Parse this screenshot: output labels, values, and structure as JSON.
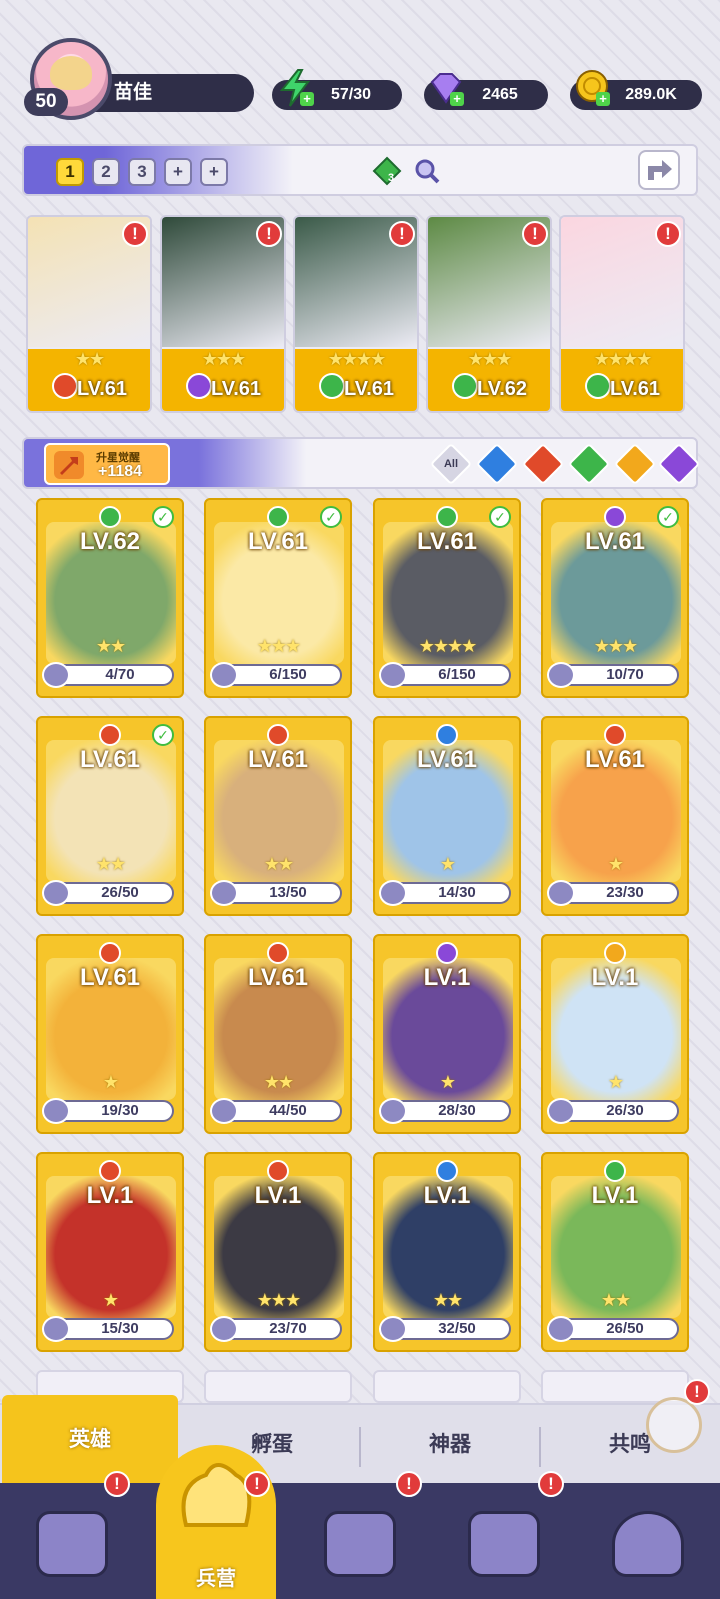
{
  "player": {
    "level": "50",
    "name": "苗佳"
  },
  "resources": {
    "energy": "57/30",
    "gems": "2465",
    "coins": "289.0K"
  },
  "team_tabs": [
    "1",
    "2",
    "3",
    "+",
    "+"
  ],
  "team_gem_count": "3",
  "team_heroes": [
    {
      "level": "LV.61",
      "element": "fire",
      "stars": "★★"
    },
    {
      "level": "LV.61",
      "element": "dark",
      "stars": "★★★"
    },
    {
      "level": "LV.61",
      "element": "wind",
      "stars": "★★★★"
    },
    {
      "level": "LV.62",
      "element": "wind",
      "stars": "★★★"
    },
    {
      "level": "LV.61",
      "element": "wind",
      "stars": "★★★★"
    }
  ],
  "star_up": {
    "label": "升星觉醒",
    "value": "+1184"
  },
  "filters": {
    "all_label": "All"
  },
  "colors": {
    "fire": "#e04a2a",
    "water": "#2f7fe0",
    "wind": "#3db54a",
    "dark": "#8a48d8",
    "light": "#f2a81c",
    "accent": "#f5c41c"
  },
  "heroes": [
    {
      "level": "LV.62",
      "element": "wind",
      "stars": "★★",
      "shards": "4/70",
      "checked": true
    },
    {
      "level": "LV.61",
      "element": "wind",
      "stars": "★★★",
      "shards": "6/150",
      "checked": true
    },
    {
      "level": "LV.61",
      "element": "wind",
      "stars": "★★★★",
      "shards": "6/150",
      "checked": true
    },
    {
      "level": "LV.61",
      "element": "dark",
      "stars": "★★★",
      "shards": "10/70",
      "checked": true
    },
    {
      "level": "LV.61",
      "element": "fire",
      "stars": "★★",
      "shards": "26/50",
      "checked": true
    },
    {
      "level": "LV.61",
      "element": "fire",
      "stars": "★★",
      "shards": "13/50",
      "checked": false
    },
    {
      "level": "LV.61",
      "element": "water",
      "stars": "★",
      "shards": "14/30",
      "checked": false
    },
    {
      "level": "LV.61",
      "element": "fire",
      "stars": "★",
      "shards": "23/30",
      "checked": false
    },
    {
      "level": "LV.61",
      "element": "fire",
      "stars": "★",
      "shards": "19/30",
      "checked": false
    },
    {
      "level": "LV.61",
      "element": "fire",
      "stars": "★★",
      "shards": "44/50",
      "checked": false
    },
    {
      "level": "LV.1",
      "element": "dark",
      "stars": "★",
      "shards": "28/30",
      "checked": false
    },
    {
      "level": "LV.1",
      "element": "light",
      "stars": "★",
      "shards": "26/30",
      "checked": false
    },
    {
      "level": "LV.1",
      "element": "fire",
      "stars": "★",
      "shards": "15/30",
      "checked": false
    },
    {
      "level": "LV.1",
      "element": "fire",
      "stars": "★★★",
      "shards": "23/70",
      "checked": false
    },
    {
      "level": "LV.1",
      "element": "water",
      "stars": "★★",
      "shards": "32/50",
      "checked": false
    },
    {
      "level": "LV.1",
      "element": "wind",
      "stars": "★★",
      "shards": "26/50",
      "checked": false
    }
  ],
  "subtabs": [
    "英雄",
    "孵蛋",
    "神器",
    "共鸣"
  ],
  "bottom_nav": {
    "active_label": "兵营"
  }
}
